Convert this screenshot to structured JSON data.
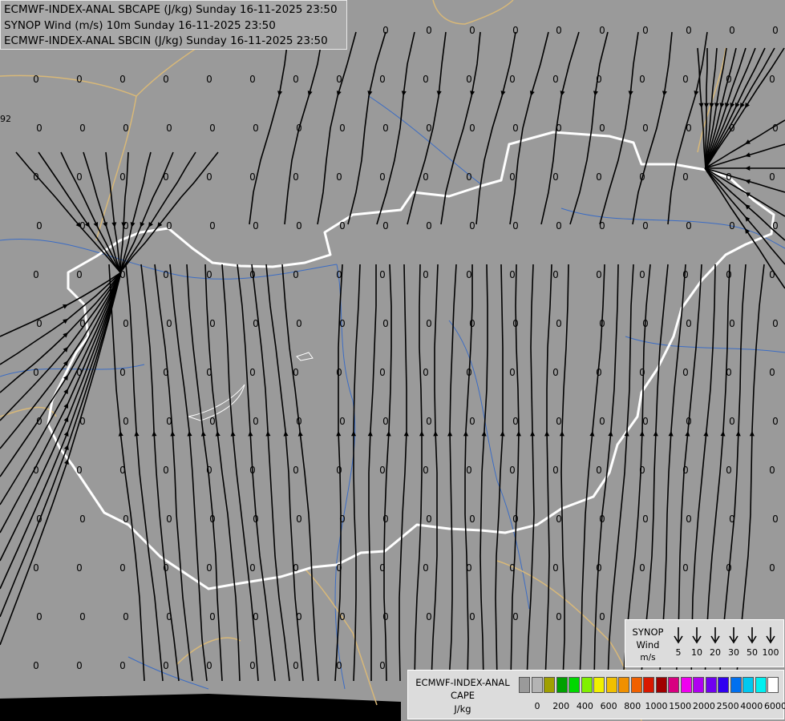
{
  "titles": [
    "ECMWF-INDEX-ANAL SBCAPE (J/kg) Sunday 16-11-2025 23:50",
    "SYNOP Wind (m/s) 10m Sunday 16-11-2025 23:50",
    "ECMWF-INDEX-ANAL SBCIN (J/kg) Sunday 16-11-2025 23:50"
  ],
  "edge_label": "92",
  "grid_value": "0",
  "colors": {
    "background": "#9a9a9a",
    "streamline": "#000000",
    "country_border": "#ffffff",
    "neighbor_border": "#d8b878",
    "river": "#3b6cc4"
  },
  "wind_legend": {
    "title": [
      "SYNOP",
      "Wind",
      "m/s"
    ],
    "speeds": [
      "5",
      "10",
      "20",
      "30",
      "50",
      "100"
    ]
  },
  "cape_legend": {
    "title": [
      "ECMWF-INDEX-ANAL",
      "CAPE",
      "J/kg"
    ],
    "tick_labels": [
      "0",
      "200",
      "400",
      "600",
      "800",
      "1000",
      "1500",
      "2000",
      "2500",
      "4000",
      "6000"
    ],
    "swatch_colors": [
      "#9a9a9a",
      "#b4b4b4",
      "#a0a000",
      "#00a000",
      "#00d800",
      "#80f000",
      "#f0f000",
      "#f0c000",
      "#f09000",
      "#f06000",
      "#d81800",
      "#a00000",
      "#d80080",
      "#f000f0",
      "#b000f0",
      "#7000f0",
      "#3000f0",
      "#0070f0",
      "#00c8f0",
      "#00f0f0",
      "#ffffff"
    ]
  }
}
